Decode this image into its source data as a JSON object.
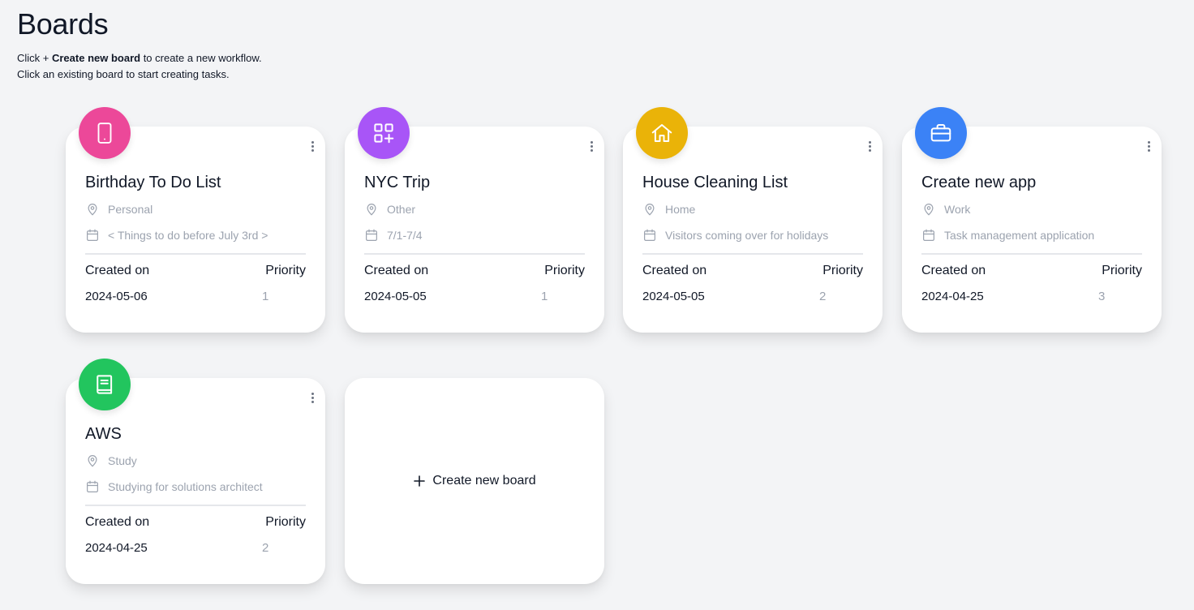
{
  "page": {
    "title": "Boards",
    "intro_line1_pre": "Click + ",
    "intro_line1_bold": "Create new board",
    "intro_line1_post": " to create a new workflow.",
    "intro_line2": "Click an existing board to start creating tasks."
  },
  "labels": {
    "created_on": "Created on",
    "priority": "Priority"
  },
  "boards": [
    {
      "title": "Birthday To Do List",
      "category": "Personal",
      "description": "< Things to do before July 3rd >",
      "created_on": "2024-05-06",
      "priority": "1",
      "color": "#ec4899",
      "icon": "tablet-icon"
    },
    {
      "title": "NYC Trip",
      "category": "Other",
      "description": "7/1-7/4",
      "created_on": "2024-05-05",
      "priority": "1",
      "color": "#a855f7",
      "icon": "squares-plus-icon"
    },
    {
      "title": "House Cleaning List",
      "category": "Home",
      "description": "Visitors coming over for holidays",
      "created_on": "2024-05-05",
      "priority": "2",
      "color": "#eab308",
      "icon": "home-icon"
    },
    {
      "title": "Create new app",
      "category": "Work",
      "description": "Task management application",
      "created_on": "2024-04-25",
      "priority": "3",
      "color": "#3b82f6",
      "icon": "briefcase-icon"
    },
    {
      "title": "AWS",
      "category": "Study",
      "description": "Studying for solutions architect",
      "created_on": "2024-04-25",
      "priority": "2",
      "color": "#22c55e",
      "icon": "book-icon"
    }
  ],
  "create_board": {
    "label": "Create new board",
    "icon": "plus-icon"
  }
}
